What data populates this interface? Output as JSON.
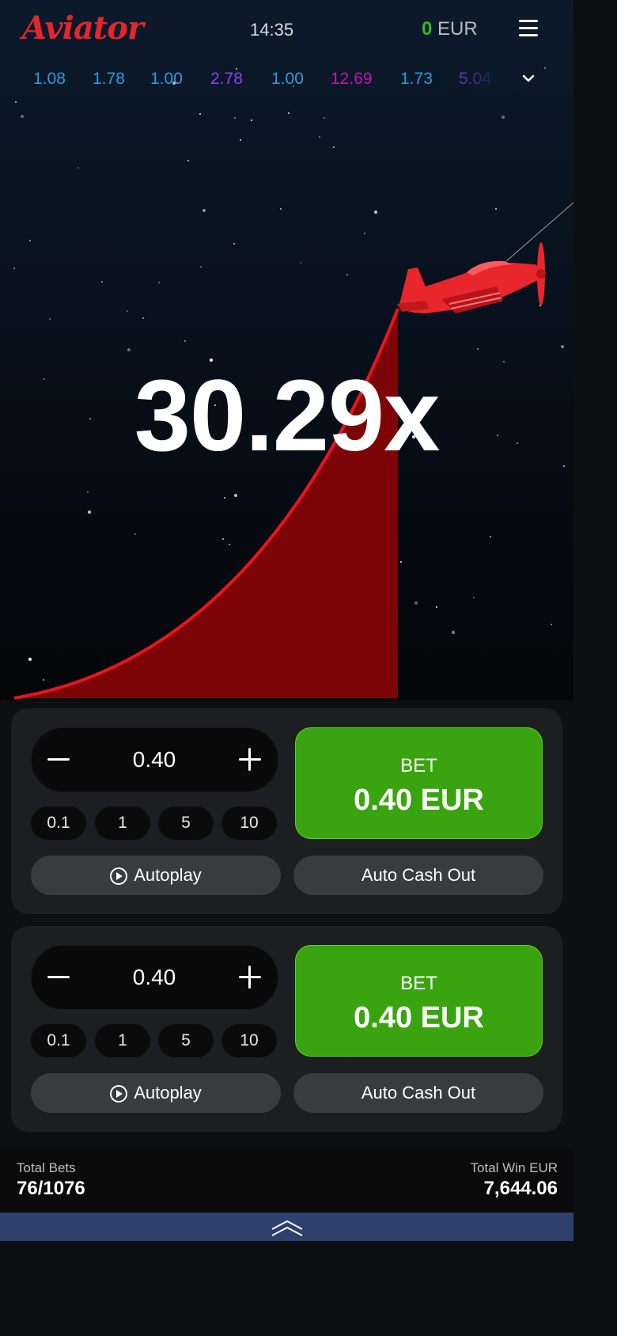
{
  "header": {
    "logo": "Aviator",
    "time": "14:35",
    "balance_amount": "0",
    "balance_currency": "EUR",
    "menu_icon": "hamburger-icon"
  },
  "history": [
    {
      "value": "1.08",
      "color": "#2f9bde"
    },
    {
      "value": "1.78",
      "color": "#2f9bde"
    },
    {
      "value": "1.00",
      "color": "#2f9bde"
    },
    {
      "value": "2.78",
      "color": "#913ef8"
    },
    {
      "value": "1.00",
      "color": "#2f9bde"
    },
    {
      "value": "12.69",
      "color": "#c017b4"
    },
    {
      "value": "1.73",
      "color": "#2f9bde"
    },
    {
      "value": "5.04",
      "color": "#913ef8"
    }
  ],
  "game": {
    "multiplier": "30.29x",
    "plane_color": "#e8262c",
    "trail_color": "#e8161c"
  },
  "panels": [
    {
      "amount": "0.40",
      "chips": [
        "0.1",
        "1",
        "5",
        "10"
      ],
      "bet_label": "BET",
      "bet_value": "0.40 EUR",
      "autoplay": "Autoplay",
      "cashout": "Auto Cash Out"
    },
    {
      "amount": "0.40",
      "chips": [
        "0.1",
        "1",
        "5",
        "10"
      ],
      "bet_label": "BET",
      "bet_value": "0.40 EUR",
      "autoplay": "Autoplay",
      "cashout": "Auto Cash Out"
    }
  ],
  "footer": {
    "total_bets_label": "Total Bets",
    "total_bets_value": "76/1076",
    "total_win_label": "Total Win EUR",
    "total_win_value": "7,644.06"
  }
}
